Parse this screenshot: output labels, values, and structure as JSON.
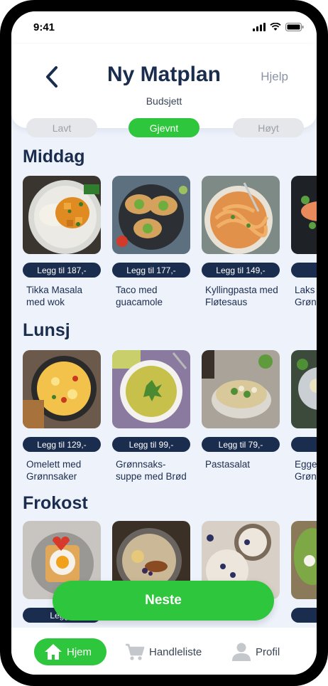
{
  "status": {
    "time": "9:41"
  },
  "header": {
    "title": "Ny Matplan",
    "help": "Hjelp",
    "budget_label": "Budsjett",
    "budget_options": [
      "Lavt",
      "Gjevnt",
      "Høyt"
    ],
    "budget_selected": "Gjevnt"
  },
  "sections": [
    {
      "title": "Middag",
      "items": [
        {
          "price": "Legg til 187,-",
          "name": "Tikka Masala\nmed wok"
        },
        {
          "price": "Legg til 177,-",
          "name": "Taco med\nguacamole"
        },
        {
          "price": "Legg til 149,-",
          "name": "Kyllingpasta med\nFløtesaus"
        },
        {
          "price": "Legg til",
          "name": "Laks\nGrøn"
        }
      ]
    },
    {
      "title": "Lunsj",
      "items": [
        {
          "price": "Legg til 129,-",
          "name": "Omelett med\nGrønnsaker"
        },
        {
          "price": "Legg til 99,-",
          "name": "Grønnsaks-\nsuppe med Brød"
        },
        {
          "price": "Legg til 79,-",
          "name": "Pastasalat"
        },
        {
          "price": "Le",
          "name": "Egge\nGrøn"
        }
      ]
    },
    {
      "title": "Frokost",
      "items": [
        {
          "price": "Legg t",
          "name": ""
        },
        {
          "price": "",
          "name": ""
        },
        {
          "price": "",
          "name": ""
        },
        {
          "price": "Le",
          "name": ""
        }
      ]
    }
  ],
  "next_label": "Neste",
  "nav": {
    "home": "Hjem",
    "shopping": "Handleliste",
    "profile": "Profil"
  },
  "colors": {
    "accent": "#2ec63c",
    "navy": "#1b2d4f",
    "background": "#eef2fb"
  }
}
